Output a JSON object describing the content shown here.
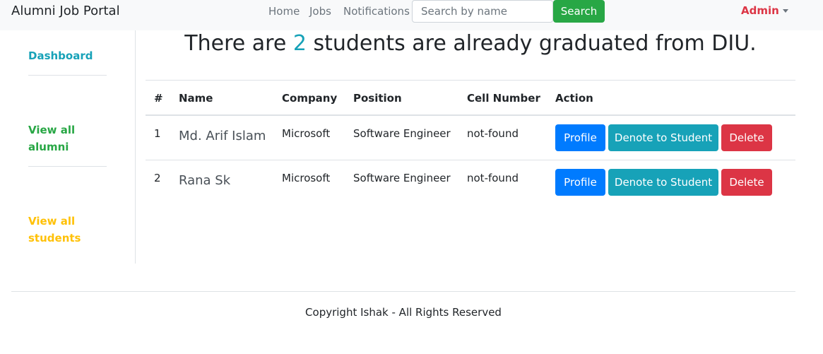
{
  "navbar": {
    "brand": "Alumni Job Portal",
    "links": [
      "Home",
      "Jobs",
      "Notifications"
    ],
    "search_placeholder": "Search by name",
    "search_button": "Search",
    "user_menu": "Admin"
  },
  "sidebar": {
    "items": [
      "Dashboard",
      "View all alumni",
      "View all students"
    ]
  },
  "main": {
    "headline_prefix": "There are ",
    "headline_count": "2",
    "headline_suffix": " students are already graduated from DIU."
  },
  "table": {
    "headers": [
      "#",
      "Name",
      "Company",
      "Position",
      "Cell Number",
      "Action"
    ],
    "rows": [
      {
        "num": "1",
        "name": "Md. Arif Islam",
        "company": "Microsoft",
        "position": "Software Engineer",
        "cell": "not-found"
      },
      {
        "num": "2",
        "name": "Rana Sk",
        "company": "Microsoft",
        "position": "Software Engineer",
        "cell": "not-found"
      }
    ],
    "actions": {
      "profile": "Profile",
      "denote": "Denote to Student",
      "delete": "Delete"
    }
  },
  "footer": {
    "text": "Copyright Ishak - All Rights Reserved"
  },
  "colors": {
    "navbar_bg": "#f8f9fa",
    "success": "#28a745",
    "danger": "#dc3545",
    "info": "#17a2b8",
    "primary": "#007bff",
    "warning": "#ffc107"
  }
}
